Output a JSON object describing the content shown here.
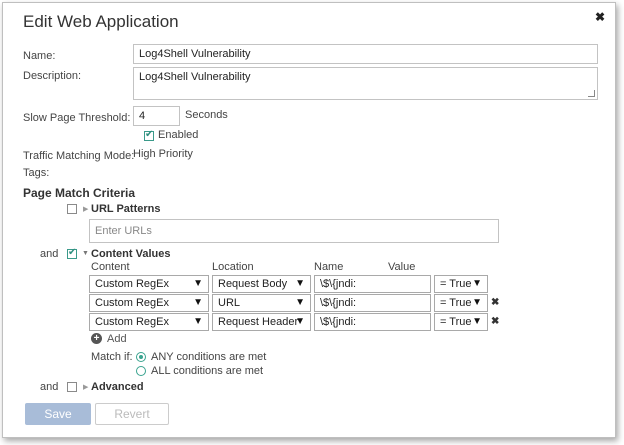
{
  "dialog": {
    "title": "Edit Web Application",
    "close_symbol": "✖"
  },
  "form": {
    "name_label": "Name:",
    "name_value": "Log4Shell Vulnerability",
    "description_label": "Description:",
    "description_value": "Log4Shell Vulnerability",
    "threshold_label": "Slow Page Threshold:",
    "threshold_value": "4",
    "threshold_unit": "Seconds",
    "enabled_label": "Enabled",
    "enabled_checked": true,
    "traffic_mode_label": "Traffic Matching Mode:",
    "traffic_mode_value": "High Priority",
    "tags_label": "Tags:"
  },
  "criteria": {
    "heading": "Page Match Criteria",
    "url_patterns_label": "URL Patterns",
    "url_placeholder": "Enter URLs",
    "and_label_1": "and",
    "content_values_label": "Content Values",
    "columns": {
      "content": "Content",
      "location": "Location",
      "name": "Name",
      "value": "Value"
    },
    "rows": [
      {
        "content": "Custom RegEx",
        "location": "Request Body",
        "name": "\\$\\{jndi:",
        "value": "= True",
        "removable": false
      },
      {
        "content": "Custom RegEx",
        "location": "URL",
        "name": "\\$\\{jndi:",
        "value": "= True",
        "removable": true
      },
      {
        "content": "Custom RegEx",
        "location": "Request Header",
        "name": "\\$\\{jndi:",
        "value": "= True",
        "removable": true
      }
    ],
    "dropdown_arrow": "▼",
    "remove_symbol": "✖",
    "add_label": "Add",
    "match_if_label": "Match if:",
    "match_any_label": "ANY conditions are met",
    "match_all_label": "ALL conditions are met",
    "match_selected": "any",
    "and_label_2": "and",
    "advanced_label": "Advanced"
  },
  "buttons": {
    "save_label": "Save",
    "revert_label": "Revert"
  }
}
